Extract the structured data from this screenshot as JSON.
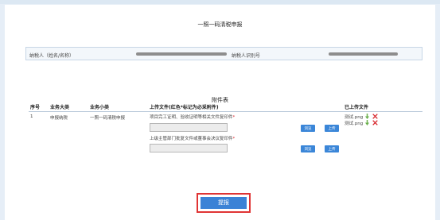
{
  "form": {
    "title": "一照一码清税申报",
    "taxpayer_name_label": "纳税人（姓名/名称）",
    "taxpayer_id_label": "纳税人识别号"
  },
  "attachments": {
    "title": "附件表",
    "headers": {
      "seq": "序号",
      "category": "业务大类",
      "subcategory": "业务小类",
      "upload_file": "上传文件(红色*标记为必采附件)",
      "uploaded": "已上传文件"
    },
    "row": {
      "seq": "1",
      "category": "申报纳税",
      "subcategory": "一照一码清税申报",
      "file_1": "项目完工证明、验收证明等相关文件复印件",
      "file_2": "上级主管部门批复文件或董事会决议复印件",
      "required_mark": "*",
      "browse_label": "浏览",
      "upload_label": "上传",
      "uploaded_files": [
        "测试.png",
        "测试.png"
      ]
    }
  },
  "submit_label": "提报",
  "colors": {
    "button_blue": "#3b86d8",
    "required_red": "#d8262c",
    "highlight_red": "#e03434",
    "download_green": "#6ab04c"
  },
  "icons": {
    "download": "download-arrow-icon",
    "delete": "delete-x-icon"
  }
}
